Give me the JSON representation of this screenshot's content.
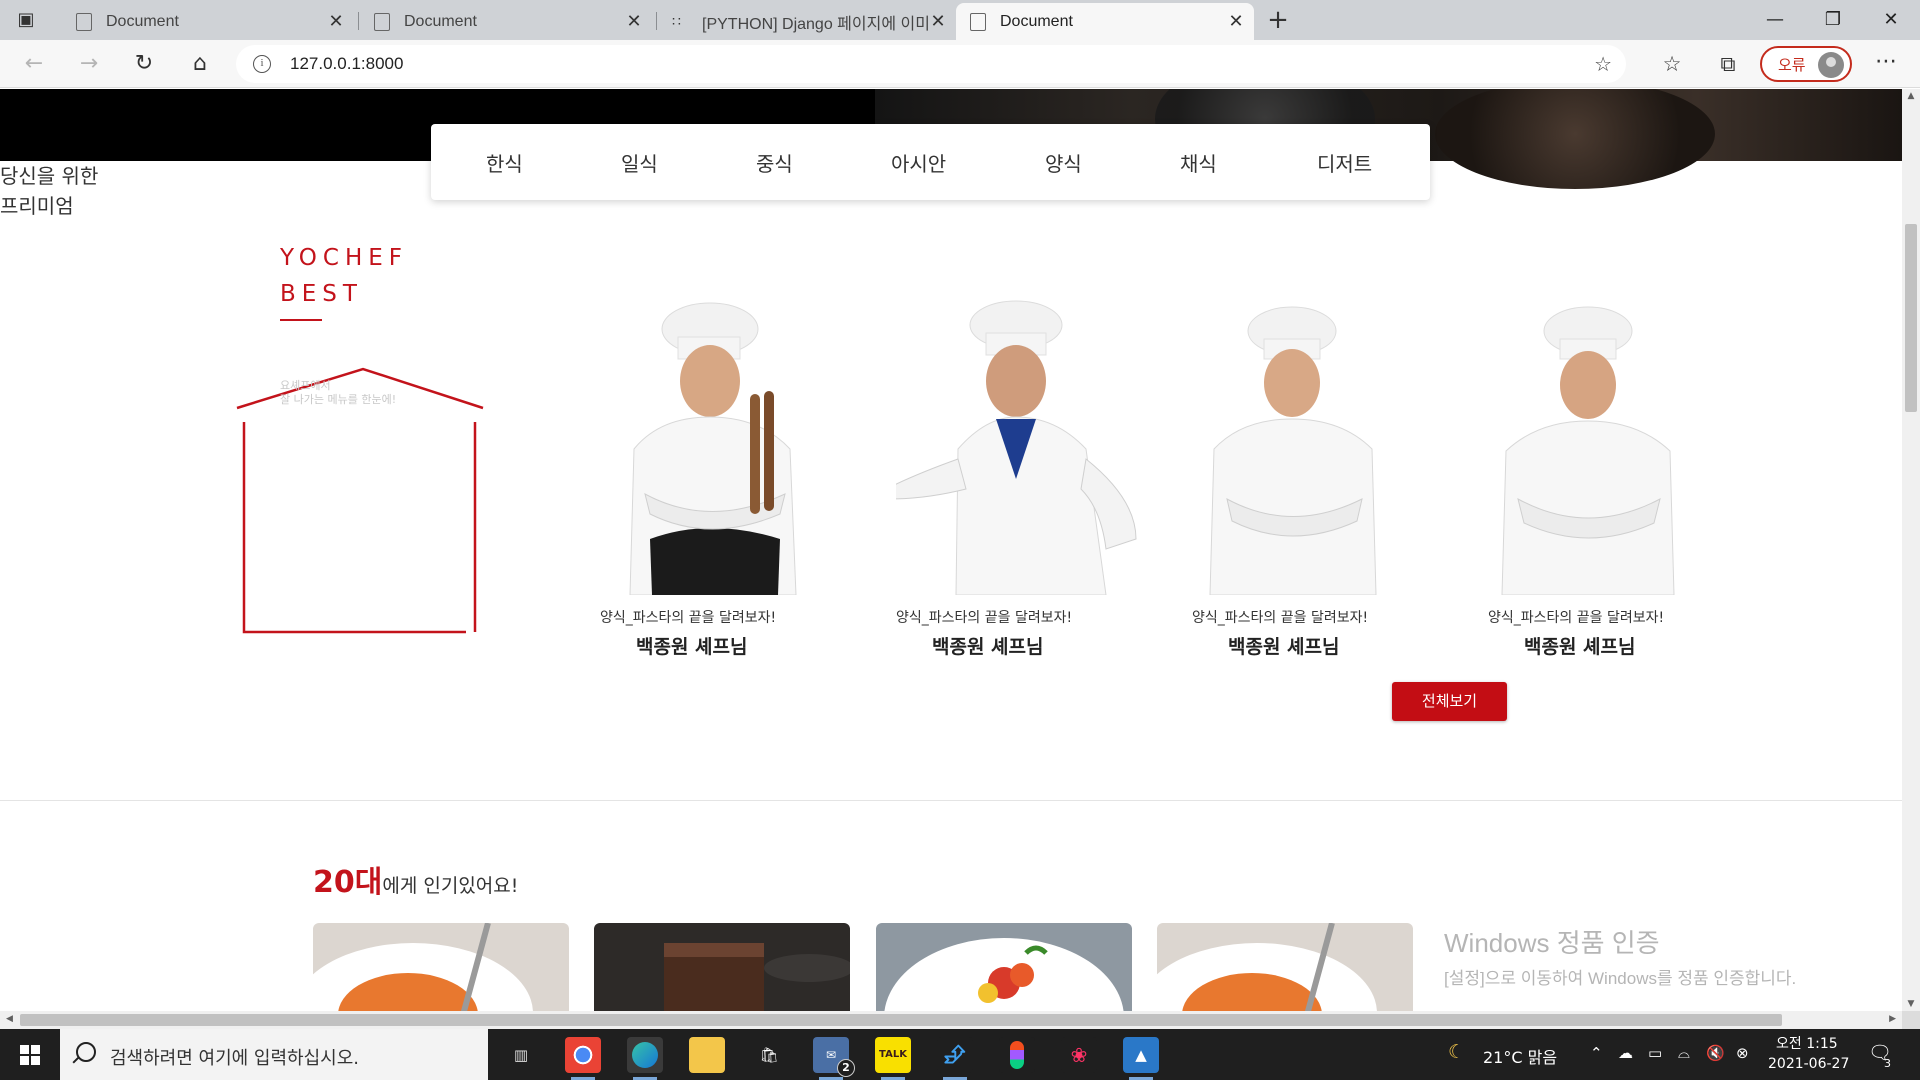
{
  "browser": {
    "tabs": [
      {
        "title": "Document",
        "active": false
      },
      {
        "title": "Document",
        "active": false
      },
      {
        "title": "[PYTHON] Django 페이지에 이미",
        "active": false
      },
      {
        "title": "Document",
        "active": true
      }
    ],
    "new_tab_icon": "plus-icon",
    "url": "127.0.0.1:8000",
    "profile_label": "오류"
  },
  "page": {
    "hero_copy": [
      "당신을 위한",
      "프리미엄"
    ],
    "categories": [
      "한식",
      "일식",
      "중식",
      "아시안",
      "양식",
      "채식",
      "디저트"
    ],
    "best": {
      "title_line1": "YOCHEF",
      "title_line2": "BEST",
      "sub_line1": "요셰프에서",
      "sub_line2": "잘 나가는 메뉴를 한눈에!"
    },
    "chefs": [
      {
        "desc": "양식_파스타의 끝을 달려보자!",
        "name": "백종원 셰프님"
      },
      {
        "desc": "양식_파스타의 끝을 달려보자!",
        "name": "백종원 셰프님"
      },
      {
        "desc": "양식_파스타의 끝을 달려보자!",
        "name": "백종원 셰프님"
      },
      {
        "desc": "양식_파스타의 끝을 달려보자!",
        "name": "백종원 셰프님"
      }
    ],
    "view_all_label": "전체보기",
    "popular": {
      "accent": "20대",
      "rest": "에게 인기있어요!"
    },
    "activation": {
      "title": "Windows 정품 인증",
      "subtitle": "[설정]으로 이동하여 Windows를 정품 인증합니다."
    },
    "accent_color": "#c3131b"
  },
  "taskbar": {
    "search_placeholder": "검색하려면 여기에 입력하십시오.",
    "mail_badge": "2",
    "kakao_label": "TALK",
    "weather": "21°C  맑음",
    "time": "오전 1:15",
    "date": "2021-06-27",
    "notification_count": "3"
  }
}
